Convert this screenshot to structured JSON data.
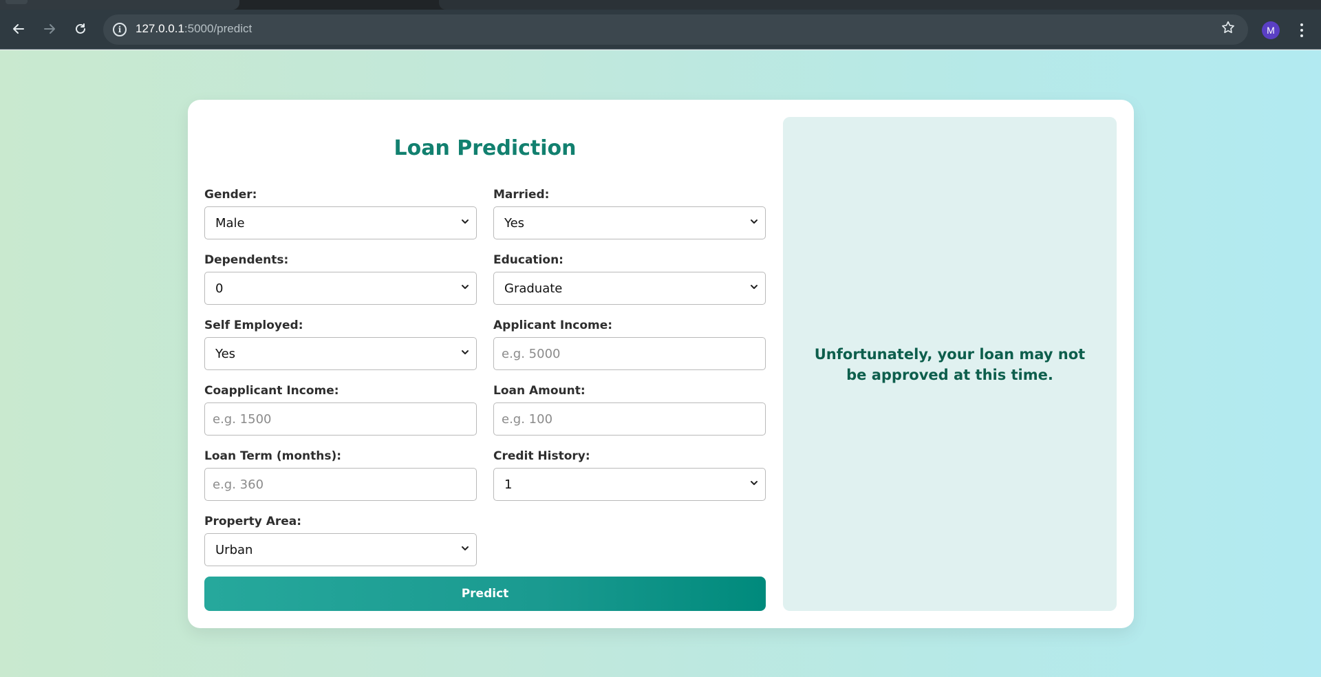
{
  "browser": {
    "url_host": "127.0.0.1",
    "url_path": ":5000/predict",
    "avatar_letter": "M",
    "icons": {
      "back": "arrow-left-icon",
      "forward": "arrow-right-icon",
      "reload": "reload-icon",
      "site_info": "info-icon",
      "bookmark": "star-icon",
      "menu": "kebab-menu-icon"
    }
  },
  "form": {
    "title": "Loan Prediction",
    "fields": {
      "gender": {
        "label": "Gender:",
        "value": "Male"
      },
      "married": {
        "label": "Married:",
        "value": "Yes"
      },
      "dependents": {
        "label": "Dependents:",
        "value": "0"
      },
      "education": {
        "label": "Education:",
        "value": "Graduate"
      },
      "self_employed": {
        "label": "Self Employed:",
        "value": "Yes"
      },
      "applicant_income": {
        "label": "Applicant Income:",
        "placeholder": "e.g. 5000"
      },
      "coapplicant_income": {
        "label": "Coapplicant Income:",
        "placeholder": "e.g. 1500"
      },
      "loan_amount": {
        "label": "Loan Amount:",
        "placeholder": "e.g. 100"
      },
      "loan_term": {
        "label": "Loan Term (months):",
        "placeholder": "e.g. 360"
      },
      "credit_history": {
        "label": "Credit History:",
        "value": "1"
      },
      "property_area": {
        "label": "Property Area:",
        "value": "Urban"
      }
    },
    "submit_label": "Predict"
  },
  "result": {
    "message": "Unfortunately, your loan may not be approved at this time."
  },
  "colors": {
    "accent": "#12806f",
    "button_start": "#26a89c",
    "button_end": "#008a7c",
    "result_bg": "#e0f1f0",
    "result_text": "#0d5e4c"
  }
}
